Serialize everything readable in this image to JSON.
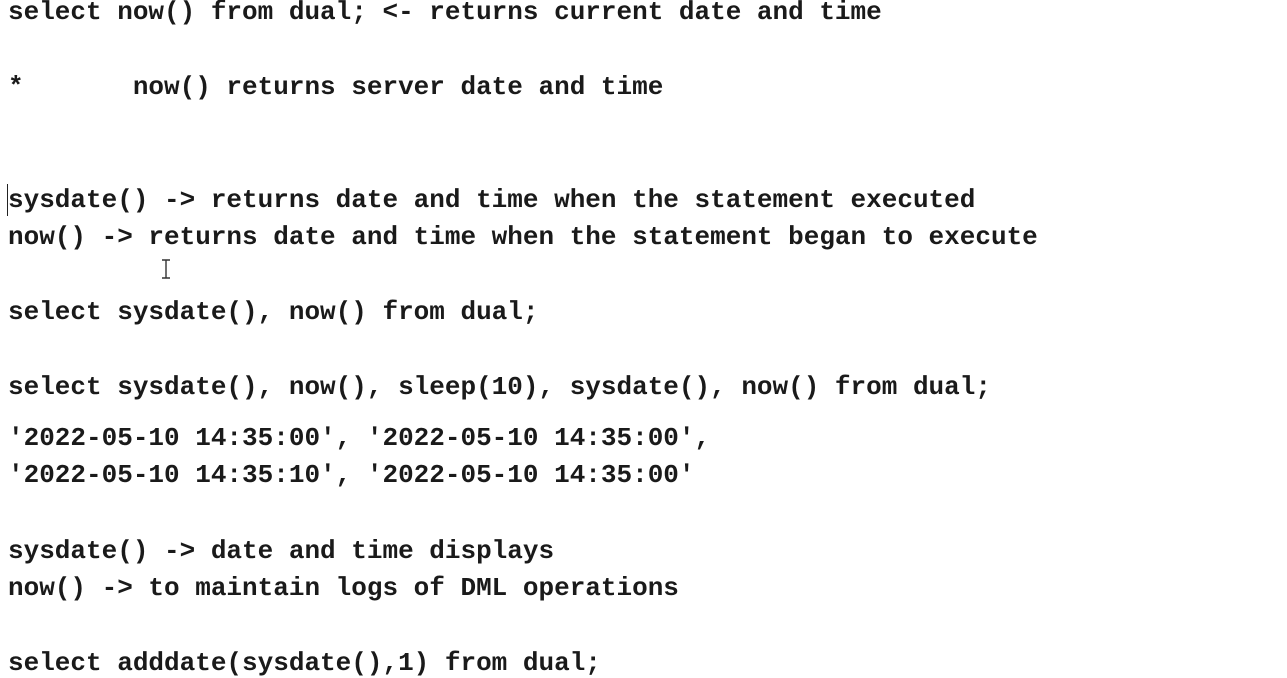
{
  "document": {
    "lines": [
      "select now() from dual; <- returns current date and time",
      "*       now() returns server date and time",
      "sysdate() -> returns date and time when the statement executed",
      "now() -> returns date and time when the statement began to execute",
      "select sysdate(), now() from dual;",
      "select sysdate(), now(), sleep(10), sysdate(), now() from dual;",
      "'2022-05-10 14:35:00', '2022-05-10 14:35:00',",
      "'2022-05-10 14:35:10', '2022-05-10 14:35:00'",
      "sysdate() -> date and time displays",
      "now() -> to maintain logs of DML operations",
      "select adddate(sysdate(),1) from dual;"
    ]
  },
  "colors": {
    "text": "#1a1a1a",
    "background": "#ffffff"
  },
  "icons": {
    "cursor": "text-cursor-icon"
  }
}
